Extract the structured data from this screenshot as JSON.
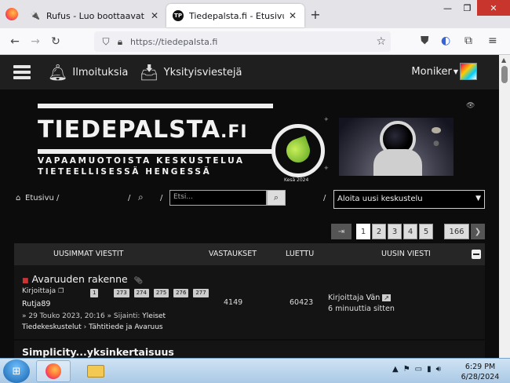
{
  "browser": {
    "tabs": [
      {
        "title": "Rufus - Luo boottaavat USB-ase",
        "active": false
      },
      {
        "title": "Tiedepalsta.fi - Etusivu",
        "active": true
      }
    ],
    "url": "https://tiedepalsta.fi",
    "window_controls": {
      "minimize": "—",
      "maximize": "❐",
      "close": "✕"
    }
  },
  "forum": {
    "topbar": {
      "notifications": "Ilmoituksia",
      "messages": "Yksityisviestejä",
      "username": "Moniker"
    },
    "banner": {
      "logo_part1": "TIEDE",
      "logo_part2": "PALSTA",
      "logo_part3": ".FI",
      "slogan_line1": "VAPAAMUOTOISTA KESKUSTELUA",
      "slogan_line2": "TIETEELLISESSÄ HENGESSÄ",
      "season": "Kesä 2024"
    },
    "breadcrumb": {
      "home": "Etusivu",
      "sep": "/"
    },
    "search": {
      "placeholder": "Etsi..."
    },
    "new_topic_select": "Aloita uusi keskustelu",
    "pagination": [
      "1",
      "2",
      "3",
      "4",
      "5",
      "166"
    ],
    "table": {
      "headers": {
        "topics": "UUSIMMAT VIESTIT",
        "replies": "VASTAUKSET",
        "views": "LUETTU",
        "last_post": "UUSIN VIESTI"
      },
      "rows": [
        {
          "title": "Avaruuden rakenne",
          "by_label": "Kirjoittaja",
          "pages": [
            "1",
            "273",
            "274",
            "275",
            "276",
            "277"
          ],
          "author": "Rutja89",
          "date_line": "» 29 Touko 2023, 20:16 » Sijainti:",
          "forum_name": "Yleiset",
          "forum_cat": "Tiedekeskustelut",
          "subforum": "Tähtitiede ja Avaruus",
          "replies": "4149",
          "views": "60423",
          "last_post_by_label": "Kirjoittaja",
          "last_post_author": "Vän",
          "last_post_time": "6 minuuttia sitten"
        },
        {
          "title": "Simplicity...yksinkertaisuus"
        }
      ]
    }
  },
  "taskbar": {
    "time": "6:29 PM",
    "date": "6/28/2024"
  }
}
